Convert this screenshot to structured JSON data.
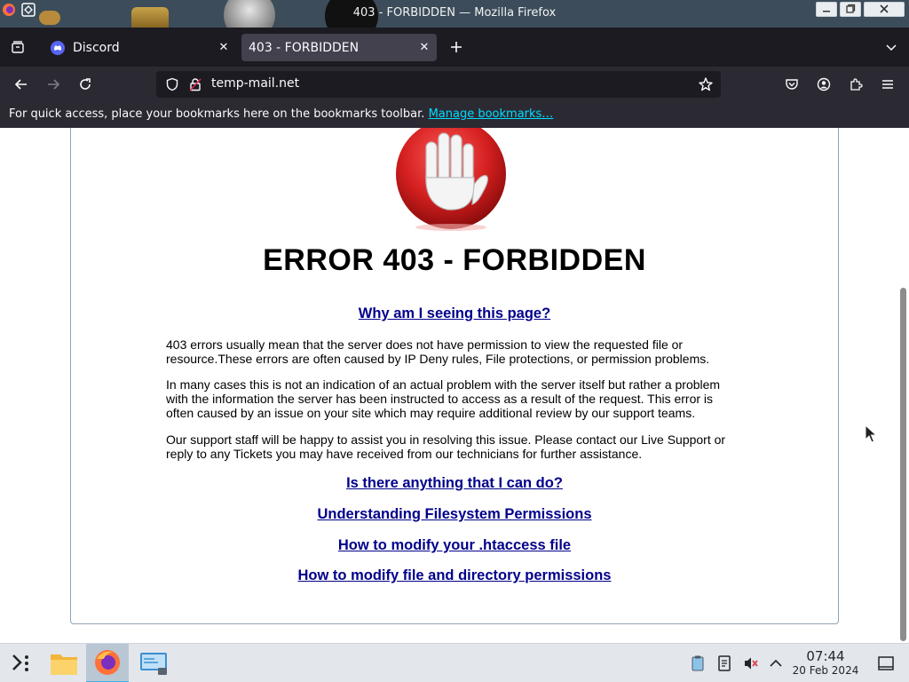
{
  "window": {
    "title": "403 - FORBIDDEN — Mozilla Firefox"
  },
  "tabs": [
    {
      "label": "Discord",
      "icon": "discord-icon",
      "active": false
    },
    {
      "label": "403 - FORBIDDEN",
      "icon": "none",
      "active": true
    }
  ],
  "navbar": {
    "url": "temp-mail.net"
  },
  "bookmarks_bar": {
    "message": "For quick access, place your bookmarks here on the bookmarks toolbar.",
    "link": "Manage bookmarks…"
  },
  "page": {
    "heading": "ERROR 403 - FORBIDDEN",
    "why_link": "Why am I seeing this page?",
    "paragraphs": [
      "403 errors usually mean that the server does not have permission to view the requested file or resource.These errors are often caused by IP Deny rules, File protections, or permission problems.",
      "In many cases this is not an indication of an actual problem with the server itself but rather a problem with the information the server has been instructed to access as a result of the request. This error is often caused by an issue on your site which may require additional review by our support teams.",
      "Our support staff will be happy to assist you in resolving this issue. Please contact our Live Support or reply to any Tickets you may have received from our technicians for further assistance."
    ],
    "help_links": [
      "Is there anything that I can do?",
      "Understanding Filesystem Permissions",
      "How to modify your .htaccess file",
      "How to modify file and directory permissions"
    ]
  },
  "taskbar": {
    "time": "07:44",
    "date": "20 Feb 2024"
  },
  "colors": {
    "link": "#00008b",
    "accent": "#00ddff",
    "stop_red": "#d41f1f"
  }
}
